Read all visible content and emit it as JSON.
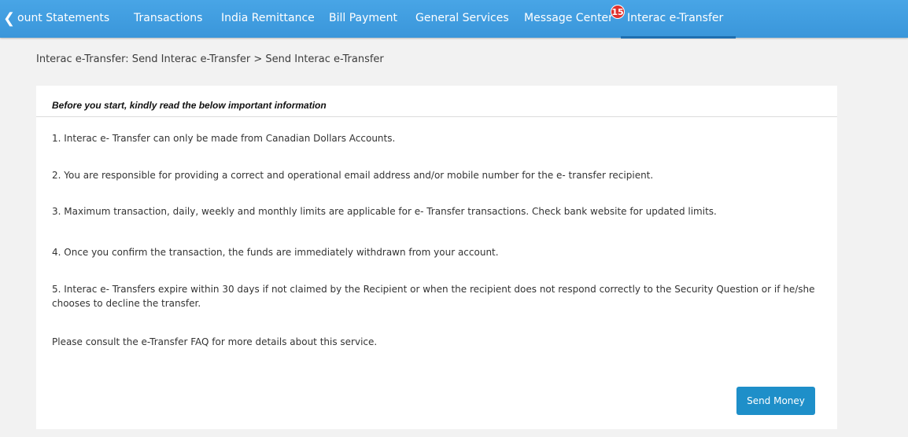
{
  "nav": {
    "items": [
      {
        "label": "ount Statements"
      },
      {
        "label": "Transactions"
      },
      {
        "label": "India Remittance"
      },
      {
        "label": "Bill Payment"
      },
      {
        "label": "General Services"
      },
      {
        "label": "Message Center"
      },
      {
        "label": "Interac e-Transfer"
      }
    ],
    "message_badge": "15",
    "active_item": "Interac e-Transfer",
    "back_icon": "chevron-left-icon"
  },
  "breadcrumb": "Interac e-Transfer: Send Interac e-Transfer > Send Interac e-Transfer",
  "card": {
    "title": "Before you start, kindly read the below important information",
    "items": [
      "1. Interac e- Transfer can only be made from Canadian Dollars Accounts.",
      "2. You are responsible for providing a correct and operational email address and/or mobile number for the e- transfer recipient.",
      "3. Maximum transaction, daily, weekly and monthly limits are applicable for e- Transfer transactions. Check bank website for updated limits.",
      "4. Once you confirm the transaction, the funds are immediately withdrawn from your account.",
      "5. Interac e- Transfers expire within 30 days if not claimed by the Recipient or when the recipient does not respond correctly to the Security Question or if he/she chooses to decline the transfer.",
      "Please consult the e-Transfer FAQ for more details about this service."
    ],
    "send_button": "Send Money"
  },
  "colors": {
    "nav_bg": "#3a96da",
    "badge": "#e0312d",
    "button": "#1e8fc9",
    "active_underline": "#1f6fb0"
  }
}
